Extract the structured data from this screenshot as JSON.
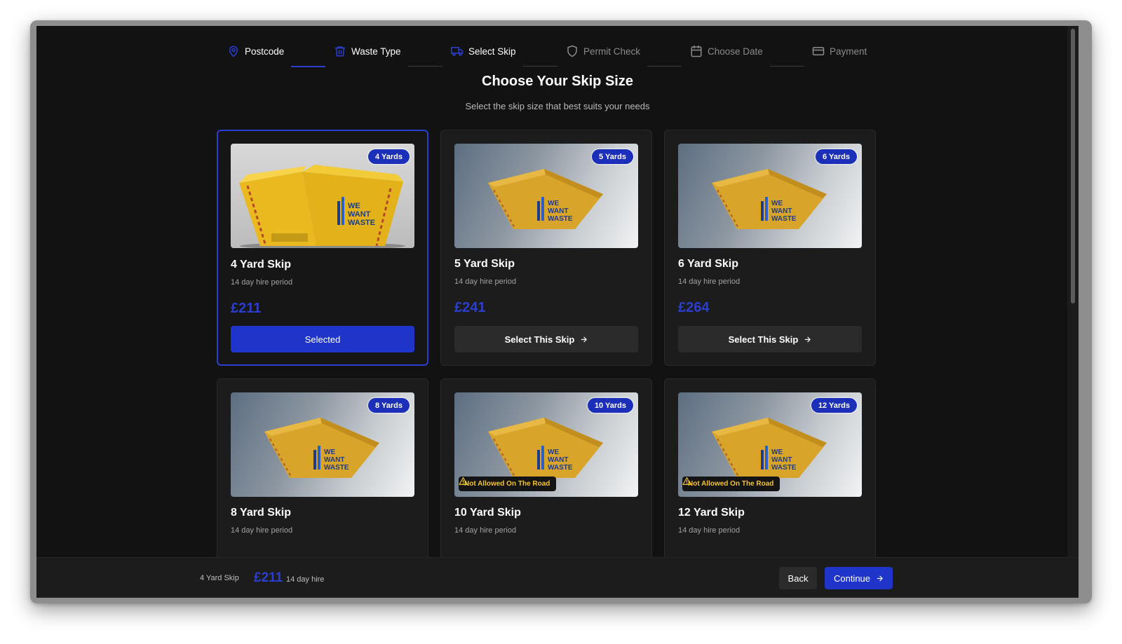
{
  "stepper": {
    "steps": [
      {
        "label": "Postcode",
        "icon": "map-pin-icon",
        "state": "done"
      },
      {
        "label": "Waste Type",
        "icon": "trash-icon",
        "state": "done"
      },
      {
        "label": "Select Skip",
        "icon": "truck-icon",
        "state": "active"
      },
      {
        "label": "Permit Check",
        "icon": "shield-icon",
        "state": "pending"
      },
      {
        "label": "Choose Date",
        "icon": "calendar-icon",
        "state": "pending"
      },
      {
        "label": "Payment",
        "icon": "credit-card-icon",
        "state": "pending"
      }
    ]
  },
  "page": {
    "title": "Choose Your Skip Size",
    "subtitle": "Select the skip size that best suits your needs"
  },
  "skips": [
    {
      "badge": "4 Yards",
      "name": "4 Yard Skip",
      "period": "14 day hire period",
      "price": "£211",
      "cta": "Selected",
      "selected": true,
      "warning": ""
    },
    {
      "badge": "5 Yards",
      "name": "5 Yard Skip",
      "period": "14 day hire period",
      "price": "£241",
      "cta": "Select This Skip",
      "selected": false,
      "warning": ""
    },
    {
      "badge": "6 Yards",
      "name": "6 Yard Skip",
      "period": "14 day hire period",
      "price": "£264",
      "cta": "Select This Skip",
      "selected": false,
      "warning": ""
    },
    {
      "badge": "8 Yards",
      "name": "8 Yard Skip",
      "period": "14 day hire period",
      "selected": false,
      "warning": ""
    },
    {
      "badge": "10 Yards",
      "name": "10 Yard Skip",
      "period": "14 day hire period",
      "selected": false,
      "warning": "Not Allowed On The Road"
    },
    {
      "badge": "12 Yards",
      "name": "12 Yard Skip",
      "period": "14 day hire period",
      "selected": false,
      "warning": "Not Allowed On The Road"
    }
  ],
  "skip_logo": [
    "WE",
    "WANT",
    "WASTE"
  ],
  "bottom_bar": {
    "selected_name": "4 Yard Skip",
    "selected_price": "£211",
    "selected_period": "14 day hire",
    "back_label": "Back",
    "continue_label": "Continue"
  },
  "colors": {
    "accent": "#1f35c9",
    "price": "#2a3fd0",
    "warning": "#f4c430",
    "background": "#121212",
    "card": "#1c1c1c"
  }
}
